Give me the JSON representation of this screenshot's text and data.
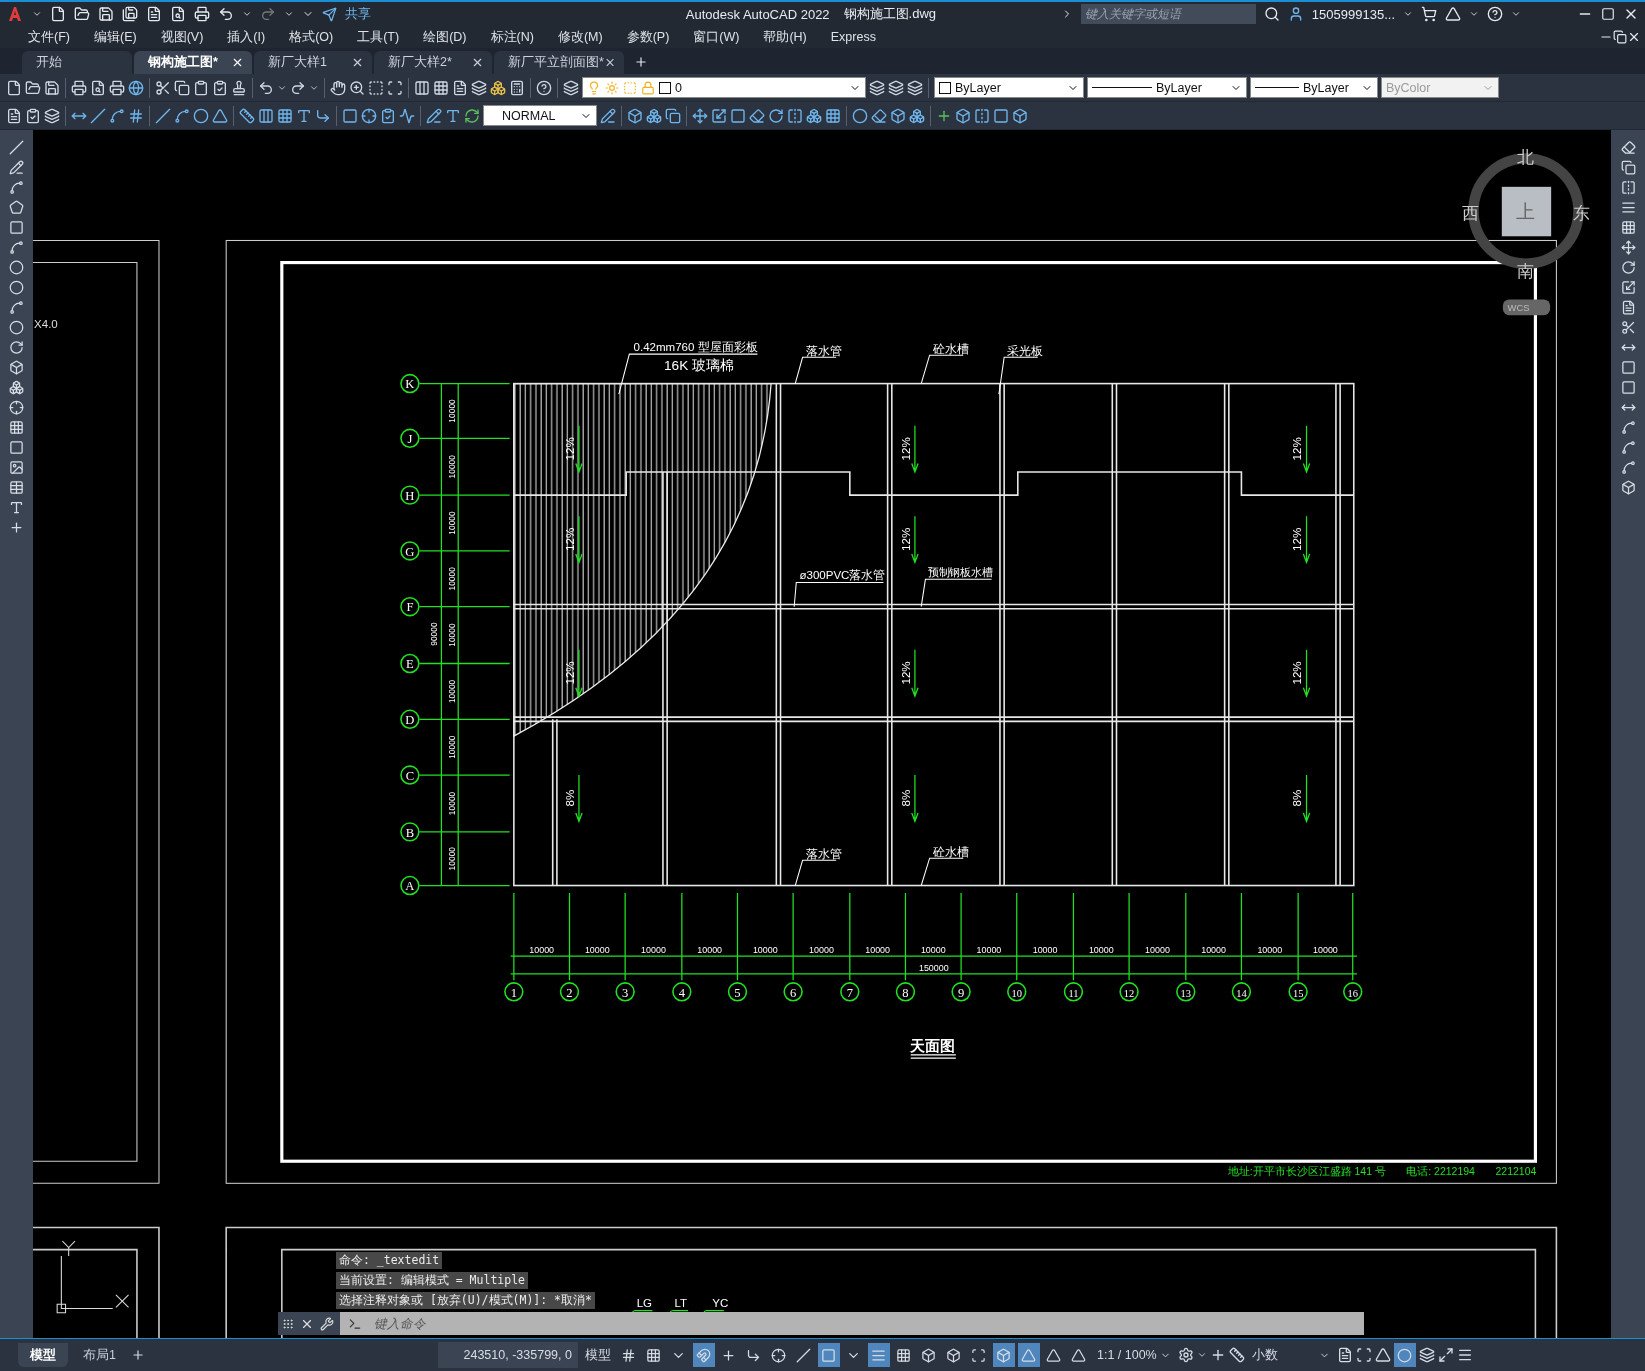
{
  "title_bar": {
    "share": "共享",
    "app_title": "Autodesk AutoCAD 2022",
    "file_name": "钢构施工图.dwg",
    "search": {
      "placeholder": "键入关键字或短语"
    },
    "user": "1505999135..."
  },
  "menu": [
    "文件(F)",
    "编辑(E)",
    "视图(V)",
    "插入(I)",
    "格式(O)",
    "工具(T)",
    "绘图(D)",
    "标注(N)",
    "修改(M)",
    "参数(P)",
    "窗口(W)",
    "帮助(H)",
    "Express"
  ],
  "file_tabs": [
    {
      "label": "开始",
      "selected": false,
      "closable": false
    },
    {
      "label": "钢构施工图*",
      "selected": true,
      "closable": true
    },
    {
      "label": "新厂大样1",
      "selected": false,
      "closable": true
    },
    {
      "label": "新厂大样2*",
      "selected": false,
      "closable": true
    },
    {
      "label": "新厂平立剖面图*",
      "selected": false,
      "closable": true
    }
  ],
  "properties": {
    "layer": "0",
    "color_setting": "ByLayer",
    "linetype": "ByLayer",
    "lineweight": "ByLayer",
    "plot_style": {
      "value": "ByColor",
      "disabled": true
    }
  },
  "dim_style": "NORMAL",
  "viewcube": {
    "north": "北",
    "east": "东",
    "south": "南",
    "west": "西",
    "face": "上",
    "ucs": "WCS"
  },
  "drawing": {
    "left_sheet_text": "X4.0",
    "row_axes": [
      "K",
      "J",
      "H",
      "G",
      "F",
      "E",
      "D",
      "C",
      "B",
      "A"
    ],
    "row_spacings": [
      "10000",
      "10000",
      "10000",
      "10000",
      "10000",
      "10000",
      "10000",
      "10000",
      "10000"
    ],
    "row_total": "90000",
    "column_axes": [
      "1",
      "2",
      "3",
      "4",
      "5",
      "6",
      "7",
      "8",
      "9",
      "10",
      "11",
      "12",
      "13",
      "14",
      "15",
      "16"
    ],
    "column_spacings": [
      "10000",
      "10000",
      "10000",
      "10000",
      "10000",
      "10000",
      "10000",
      "10000",
      "10000",
      "10000",
      "10000",
      "10000",
      "10000",
      "10000",
      "10000"
    ],
    "column_total": "150000",
    "notes": [
      "0.42mm760 型屋面彩板",
      "16K 玻璃棉",
      "落水管",
      "砼水槽",
      "采光板",
      "ø300PVC落水管",
      "预制钢板水槽",
      "落水管",
      "砼水槽"
    ],
    "slopes": [
      "12%",
      "12%",
      "12%",
      "12%",
      "12%",
      "12%",
      "12%",
      "12%",
      "12%",
      "8%",
      "8%",
      "8%"
    ],
    "title": "天面图",
    "footer": [
      "地址:开平市长沙区江盛路 141 号",
      "电话: 2212194",
      "2212104"
    ],
    "lower_labels": [
      "LG",
      "LT",
      "YC"
    ]
  },
  "command_line": {
    "history": [
      "命令: _textedit",
      "当前设置: 编辑模式 = Multiple",
      "选择注释对象或 [放弃(U)/模式(M)]: *取消*"
    ],
    "placeholder": "键入命令"
  },
  "layout_tabs": [
    {
      "label": "模型",
      "selected": true
    },
    {
      "label": "布局1",
      "selected": false
    }
  ],
  "status_bar": {
    "coordinates": "243510, -335799, 0",
    "space": "模型",
    "toggles": [
      {
        "on": false
      },
      {
        "on": false
      },
      {
        "on": false
      },
      {
        "on": true
      },
      {
        "on": false
      },
      {
        "on": false
      },
      {
        "on": false
      },
      {
        "on": false
      },
      {
        "on": true
      },
      {
        "on": false
      },
      {
        "on": true
      },
      {
        "on": false
      },
      {
        "on": false
      },
      {
        "on": false
      },
      {
        "on": false
      },
      {
        "on": true
      },
      {
        "on": true
      },
      {
        "on": false
      },
      {
        "on": false
      }
    ],
    "scale": "1:1 / 100%",
    "units": "小数",
    "isolate": {
      "on": true
    }
  }
}
